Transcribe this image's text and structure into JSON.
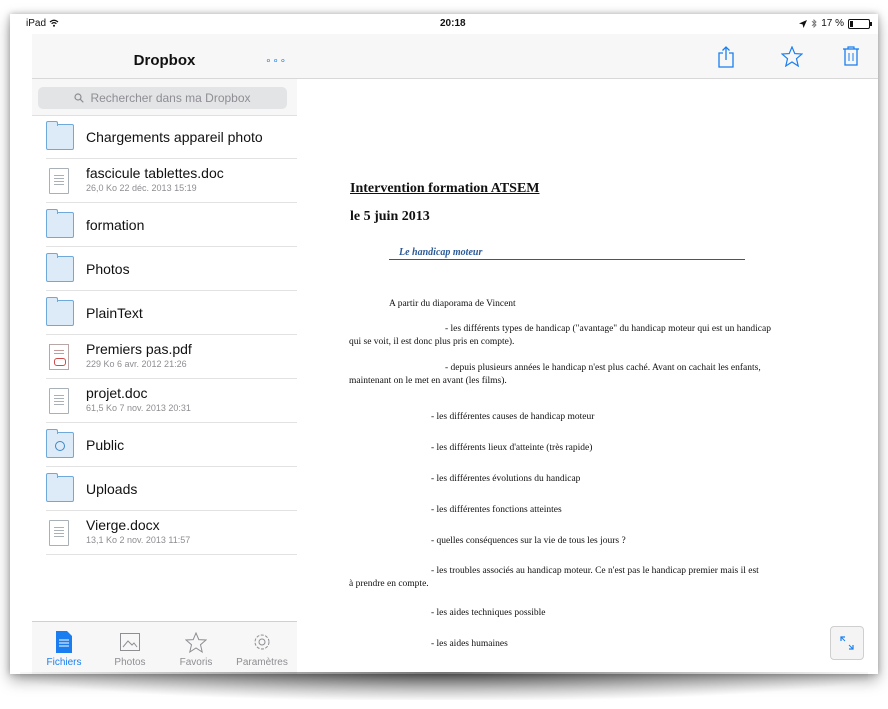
{
  "status": {
    "device": "iPad",
    "time": "20:18",
    "battery": "17 %",
    "battery_level": 0.17
  },
  "sidebar": {
    "title": "Dropbox",
    "more_label": "∘∘∘",
    "search_placeholder": "Rechercher dans ma Dropbox",
    "items": [
      {
        "type": "folder",
        "name": "Chargements appareil photo"
      },
      {
        "type": "doc",
        "name": "fascicule tablettes.doc",
        "meta": "26,0 Ko  22 déc. 2013 15:19"
      },
      {
        "type": "folder",
        "name": "formation"
      },
      {
        "type": "folder",
        "name": "Photos"
      },
      {
        "type": "folder",
        "name": "PlainText"
      },
      {
        "type": "pdf",
        "name": "Premiers pas.pdf",
        "meta": "229 Ko  6 avr. 2012 21:26"
      },
      {
        "type": "doc",
        "name": "projet.doc",
        "meta": "61,5 Ko  7 nov. 2013 20:31"
      },
      {
        "type": "public",
        "name": "Public"
      },
      {
        "type": "folder",
        "name": "Uploads"
      },
      {
        "type": "doc",
        "name": "Vierge.docx",
        "meta": "13,1 Ko  2 nov. 2013 11:57"
      }
    ],
    "tabs": [
      {
        "label": "Fichiers",
        "icon": "files-icon",
        "active": true
      },
      {
        "label": "Photos",
        "icon": "photos-icon",
        "active": false
      },
      {
        "label": "Favoris",
        "icon": "star-icon",
        "active": false
      },
      {
        "label": "Paramètres",
        "icon": "gear-icon",
        "active": false
      }
    ]
  },
  "toolbar": {
    "buttons": [
      "share-icon",
      "star-icon",
      "trash-icon"
    ]
  },
  "document": {
    "title": "Intervention  formation ATSEM",
    "date": "le 5 juin 2013",
    "section": "Le handicap moteur",
    "intro": "A partir du diaporama de Vincent",
    "p1a": "- les différents types de handicap (\"avantage\" du handicap moteur  qui est un handicap",
    "p1b": "qui se voit, il est donc plus pris en compte).",
    "p2a": "- depuis plusieurs années le handicap n'est plus caché. Avant on cachait les enfants,",
    "p2b": "maintenant on le met en avant (les films).",
    "p3": "- les différentes causes de handicap moteur",
    "p4": "- les différents lieux d'atteinte (très rapide)",
    "p5": "- les différentes évolutions du handicap",
    "p6": "- les différentes fonctions atteintes",
    "p7": "- quelles conséquences sur la vie de tous les jours ?",
    "p8a": "- les troubles associés au handicap moteur. Ce n'est pas le handicap premier mais il est",
    "p8b": "à prendre en compte.",
    "p9": "- les aides techniques possible",
    "p10": "- les aides humaines"
  }
}
